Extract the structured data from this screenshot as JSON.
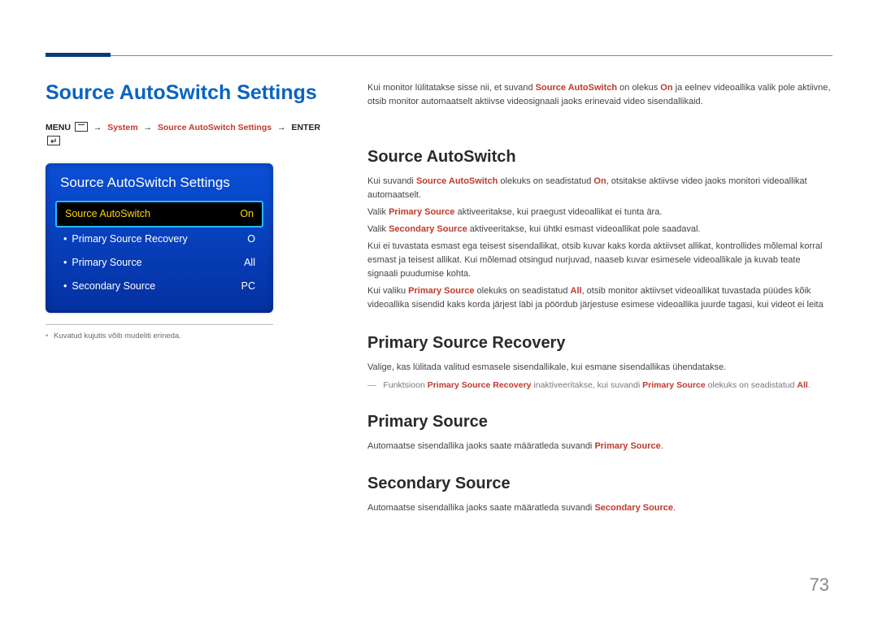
{
  "page_number": "73",
  "left": {
    "section_title": "Source AutoSwitch Settings",
    "breadcrumb": {
      "menu": "MENU",
      "arrow": "→",
      "system": "System",
      "sas": "Source AutoSwitch Settings",
      "enter": "ENTER"
    },
    "osd": {
      "title": "Source AutoSwitch Settings",
      "rows": [
        {
          "label": "Source AutoSwitch",
          "value": "On",
          "selected": true,
          "sub": false
        },
        {
          "label": "Primary Source Recovery",
          "value": "O",
          "selected": false,
          "sub": true
        },
        {
          "label": "Primary Source",
          "value": "All",
          "selected": false,
          "sub": true
        },
        {
          "label": "Secondary Source",
          "value": "PC",
          "selected": false,
          "sub": true
        }
      ]
    },
    "footnote": "Kuvatud kujutis võib mudeliti erineda."
  },
  "right": {
    "intro_a": "Kui monitor lülitatakse sisse nii, et suvand ",
    "intro_b": "Source AutoSwitch",
    "intro_c": " on olekus ",
    "intro_d": "On",
    "intro_e": " ja eelnev videoallika valik pole aktiivne, otsib monitor automaatselt aktiivse videosignaali jaoks erinevaid video sisendallikaid.",
    "h_sas": "Source AutoSwitch",
    "sas_p1_a": "Kui suvandi ",
    "sas_p1_b": "Source AutoSwitch",
    "sas_p1_c": " olekuks on seadistatud ",
    "sas_p1_d": "On",
    "sas_p1_e": ", otsitakse aktiivse video jaoks monitori videoallikat automaatselt.",
    "sas_p2_a": "Valik ",
    "sas_p2_b": "Primary Source",
    "sas_p2_c": " aktiveeritakse, kui praegust videoallikat ei tunta ära.",
    "sas_p3_a": "Valik ",
    "sas_p3_b": "Secondary Source",
    "sas_p3_c": " aktiveeritakse, kui ühtki esmast videoallikat pole saadaval.",
    "sas_p4": "Kui ei tuvastata esmast ega teisest sisendallikat, otsib kuvar kaks korda aktiivset allikat, kontrollides mõlemal korral esmast ja teisest allikat. Kui mõlemad otsingud nurjuvad, naaseb kuvar esimesele videoallikale ja kuvab teate signaali puudumise kohta.",
    "sas_p5_a": "Kui valiku ",
    "sas_p5_b": "Primary Source",
    "sas_p5_c": " olekuks on seadistatud ",
    "sas_p5_d": "All",
    "sas_p5_e": ", otsib monitor aktiivset videoallikat tuvastada püüdes kõik videoallika sisendid kaks korda järjest läbi ja pöördub järjestuse esimese videoallika juurde tagasi, kui videot ei leita",
    "h_psr": "Primary Source Recovery",
    "psr_p": "Valige, kas lülitada valitud esmasele sisendallikale, kui esmane sisendallikas ühendatakse.",
    "psr_note_a": "Funktsioon ",
    "psr_note_b": "Primary Source Recovery",
    "psr_note_c": " inaktiveeritakse, kui suvandi ",
    "psr_note_d": "Primary Source",
    "psr_note_e": " olekuks on seadistatud ",
    "psr_note_f": "All",
    "psr_note_g": ".",
    "h_ps": "Primary Source",
    "ps_p_a": "Automaatse sisendallika jaoks saate määratleda suvandi ",
    "ps_p_b": "Primary Source",
    "ps_p_c": ".",
    "h_ss": "Secondary Source",
    "ss_p_a": "Automaatse sisendallika jaoks saate määratleda suvandi ",
    "ss_p_b": "Secondary Source",
    "ss_p_c": "."
  }
}
